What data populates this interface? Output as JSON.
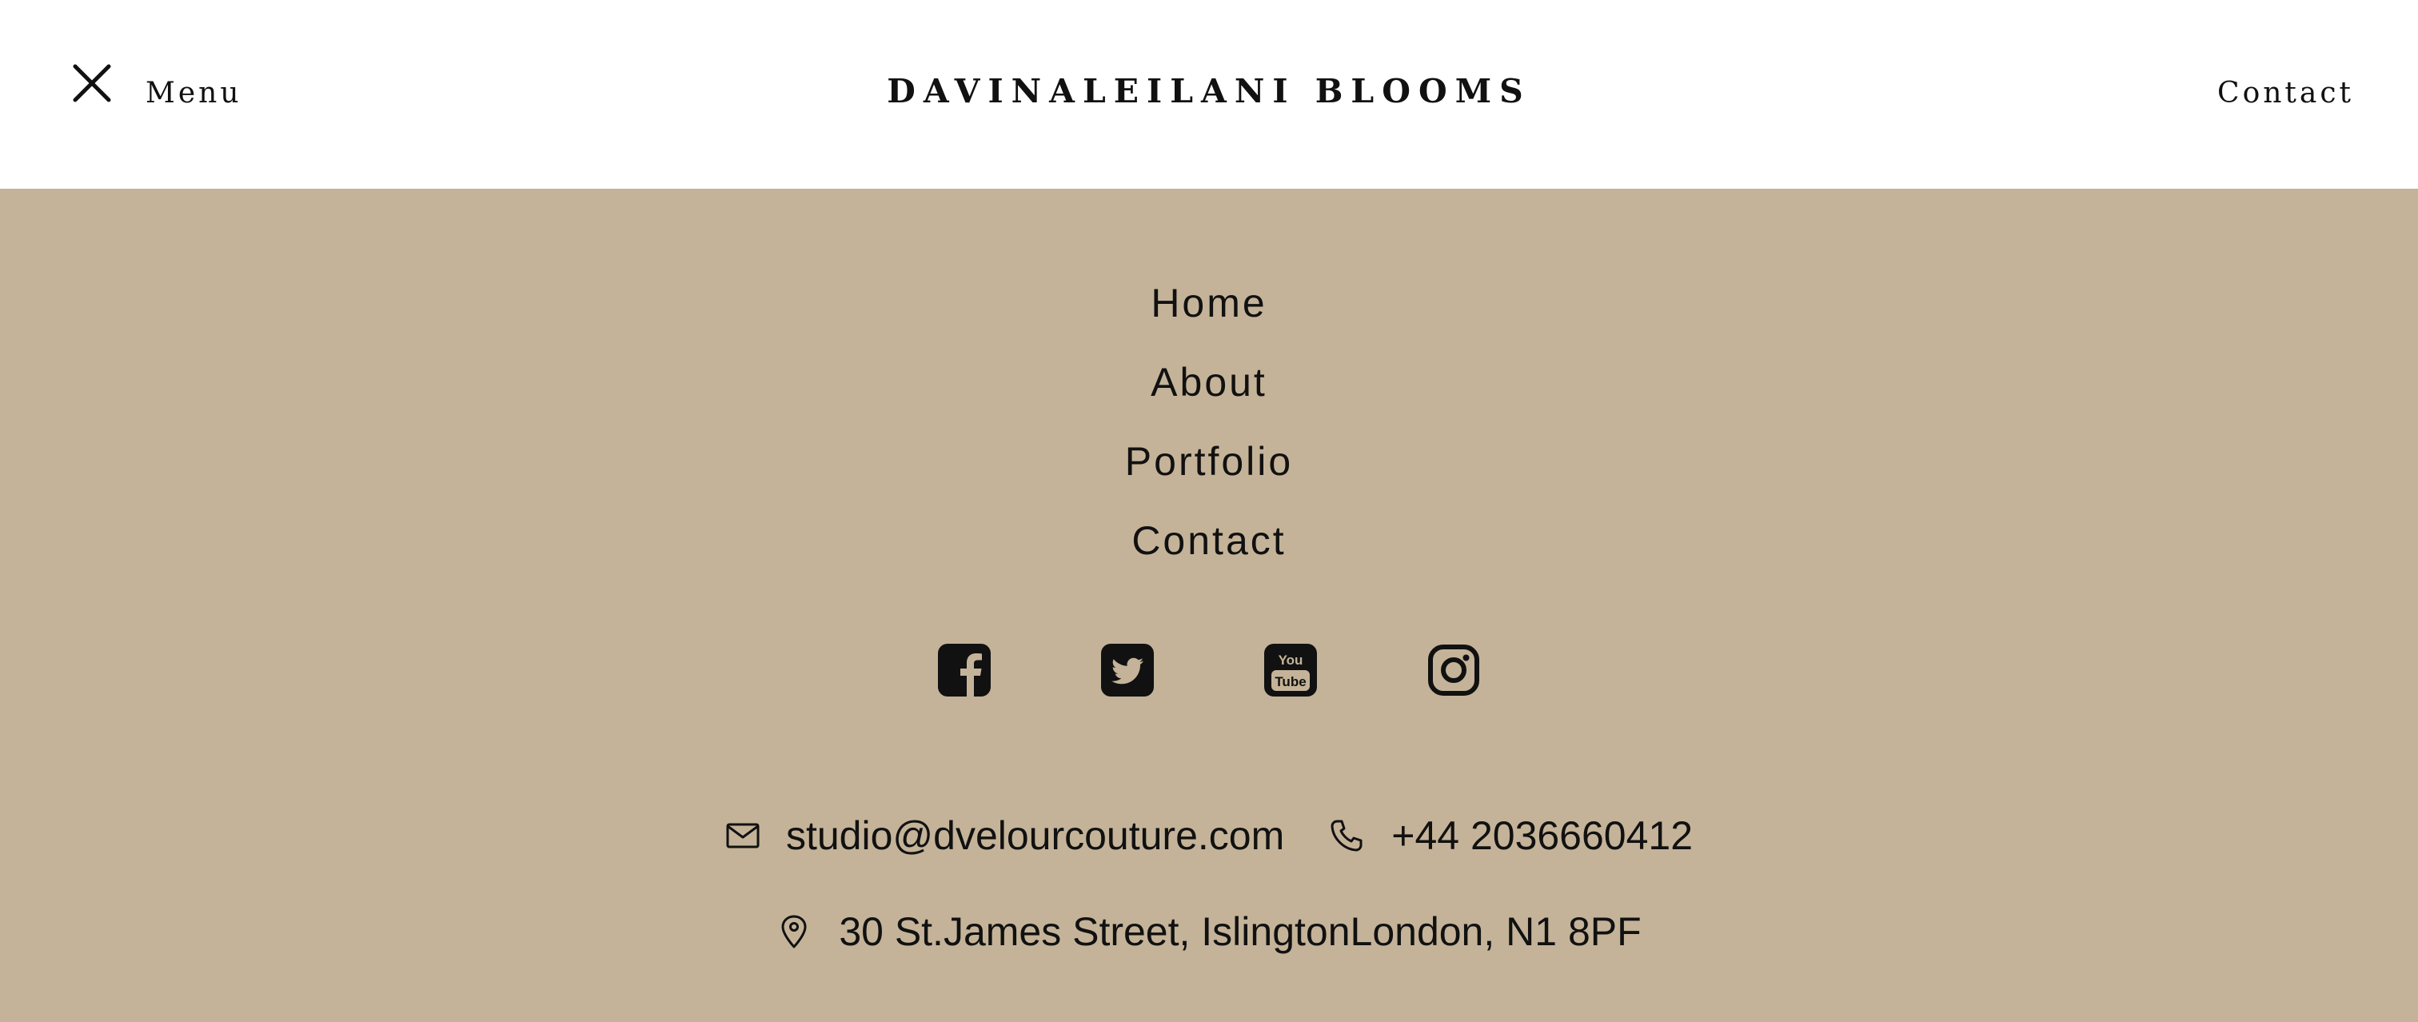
{
  "header": {
    "menu_label": "Menu",
    "brand": "DAVINALEILANI BLOOMS",
    "contact_label": "Contact"
  },
  "nav": {
    "items": [
      {
        "label": "Home"
      },
      {
        "label": "About"
      },
      {
        "label": "Portfolio"
      },
      {
        "label": "Contact"
      }
    ]
  },
  "social": [
    "facebook-icon",
    "twitter-icon",
    "youtube-icon",
    "instagram-icon"
  ],
  "contact": {
    "email": "studio@dvelourcouture.com",
    "phone": "+44 2036660412",
    "address": "30 St.James Street, IslingtonLondon, N1 8PF"
  },
  "colors": {
    "header_bg": "#ffffff",
    "menu_bg": "#c4b398",
    "text": "#111111"
  }
}
